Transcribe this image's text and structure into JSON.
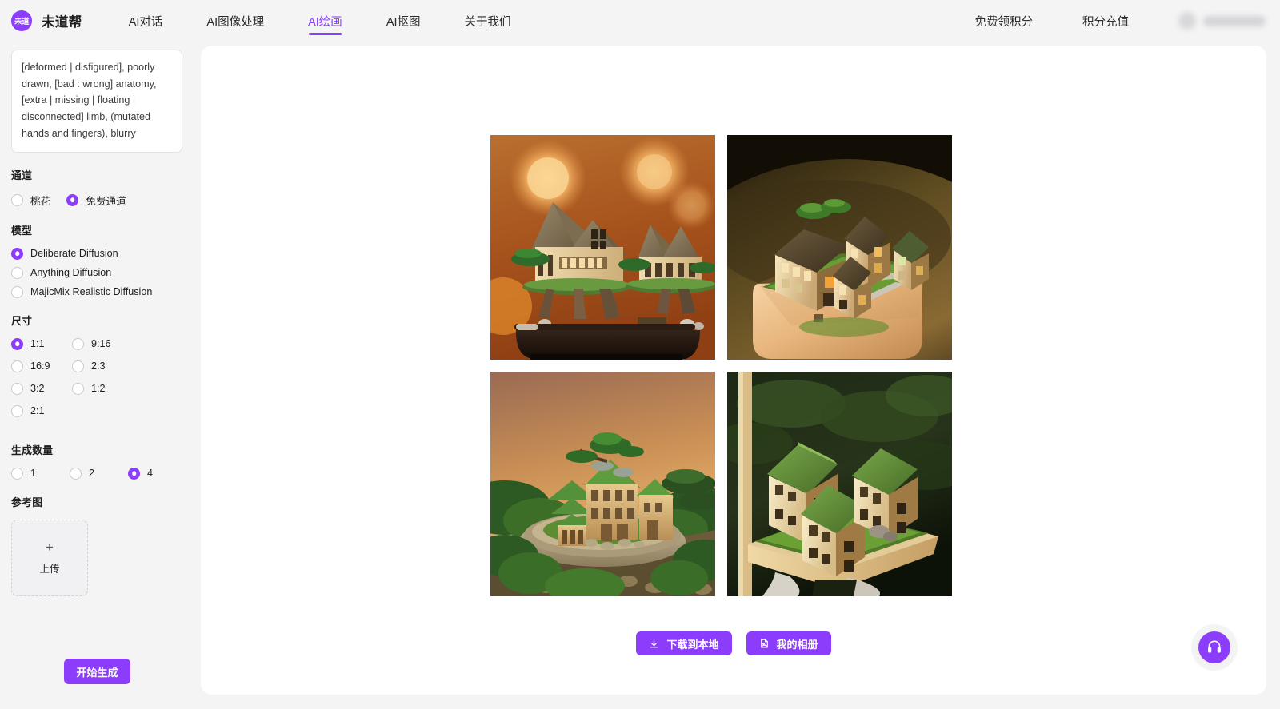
{
  "header": {
    "logo_text": "未道",
    "brand_name": "未道帮",
    "nav": [
      {
        "label": "AI对话",
        "active": false
      },
      {
        "label": "AI图像处理",
        "active": false
      },
      {
        "label": "AI绘画",
        "active": true
      },
      {
        "label": "AI抠图",
        "active": false
      },
      {
        "label": "关于我们",
        "active": false
      }
    ],
    "links": [
      {
        "label": "免费领积分"
      },
      {
        "label": "积分充值"
      }
    ],
    "user": {
      "avatar": "user-avatar-blurred",
      "name": ""
    }
  },
  "sidebar": {
    "prompt": {
      "value": "[deformed | disfigured], poorly drawn, [bad : wrong] anatomy, [extra | missing | floating | disconnected] limb, (mutated hands and fingers), blurry",
      "placeholder": ""
    },
    "channel": {
      "title": "通道",
      "options": [
        {
          "label": "桃花",
          "selected": false
        },
        {
          "label": "免费通道",
          "selected": true
        }
      ]
    },
    "model": {
      "title": "模型",
      "options": [
        {
          "label": "Deliberate Diffusion",
          "selected": true
        },
        {
          "label": "Anything Diffusion",
          "selected": false
        },
        {
          "label": "MajicMix Realistic Diffusion",
          "selected": false
        }
      ]
    },
    "size": {
      "title": "尺寸",
      "options": [
        {
          "label": "1:1",
          "selected": true
        },
        {
          "label": "9:16",
          "selected": false
        },
        {
          "label": "16:9",
          "selected": false
        },
        {
          "label": "2:3",
          "selected": false
        },
        {
          "label": "3:2",
          "selected": false
        },
        {
          "label": "1:2",
          "selected": false
        },
        {
          "label": "2:1",
          "selected": false
        }
      ]
    },
    "count": {
      "title": "生成数量",
      "options": [
        {
          "label": "1",
          "selected": false
        },
        {
          "label": "2",
          "selected": false
        },
        {
          "label": "4",
          "selected": true
        }
      ]
    },
    "reference": {
      "title": "参考图",
      "plus": "+",
      "upload_label": "上传"
    },
    "generate_label": "开始生成"
  },
  "main": {
    "images": [
      {
        "alt": "miniature bonsai houses on dark planter, orange bokeh背景",
        "theme": "orange-bokeh"
      },
      {
        "alt": "miniature village on rounded planter, dark background",
        "theme": "dark-planter"
      },
      {
        "alt": "miniature green-roof mansion on stone cliff, sunset sky",
        "theme": "sunset-cliff"
      },
      {
        "alt": "three green-roof wooden houses on grass platform",
        "theme": "green-grass"
      }
    ],
    "actions": [
      {
        "label": "下载到本地",
        "icon": "download-icon"
      },
      {
        "label": "我的相册",
        "icon": "album-icon"
      }
    ]
  },
  "fab": {
    "icon": "headset-icon",
    "label": "客服"
  },
  "colors": {
    "accent": "#8b3dfb",
    "page_bg": "#f4f4f5",
    "panel_bg": "#ffffff",
    "text": "#1d1d1f"
  }
}
